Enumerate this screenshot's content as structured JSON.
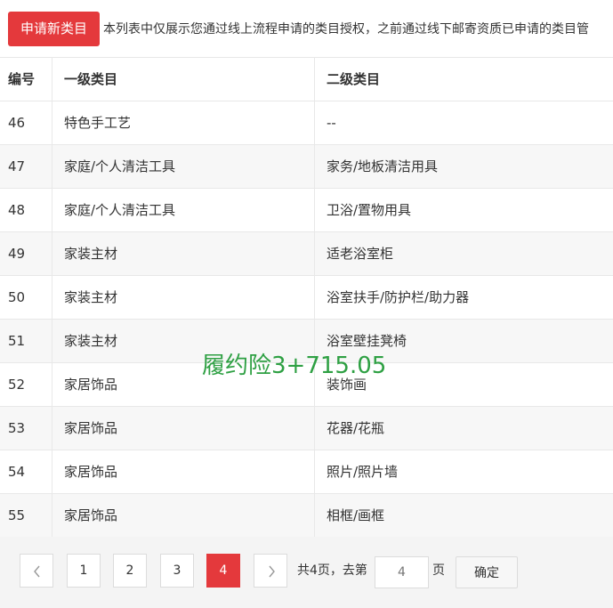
{
  "toolbar": {
    "apply_label": "申请新类目",
    "notice": "本列表中仅展示您通过线上流程申请的类目授权，之前通过线下邮寄资质已申请的类目管"
  },
  "table": {
    "headers": [
      "编号",
      "一级类目",
      "二级类目"
    ],
    "rows": [
      {
        "id": "46",
        "level1": "特色手工艺",
        "level2": "--"
      },
      {
        "id": "47",
        "level1": "家庭/个人清洁工具",
        "level2": "家务/地板清洁用具"
      },
      {
        "id": "48",
        "level1": "家庭/个人清洁工具",
        "level2": "卫浴/置物用具"
      },
      {
        "id": "49",
        "level1": "家装主材",
        "level2": "适老浴室柜"
      },
      {
        "id": "50",
        "level1": "家装主材",
        "level2": "浴室扶手/防护栏/助力器"
      },
      {
        "id": "51",
        "level1": "家装主材",
        "level2": "浴室壁挂凳椅"
      },
      {
        "id": "52",
        "level1": "家居饰品",
        "level2": "装饰画"
      },
      {
        "id": "53",
        "level1": "家居饰品",
        "level2": "花器/花瓶"
      },
      {
        "id": "54",
        "level1": "家居饰品",
        "level2": "照片/照片墙"
      },
      {
        "id": "55",
        "level1": "家居饰品",
        "level2": "相框/画框"
      }
    ]
  },
  "overlay": {
    "watermark": "履约险3+715.05",
    "color": "#2ea043"
  },
  "pagination": {
    "pages": [
      "1",
      "2",
      "3",
      "4"
    ],
    "current": "4",
    "prev_icon": "chevron-left-icon",
    "next_icon": "chevron-right-icon",
    "total_text": "共4页，去第",
    "input_placeholder": "4",
    "unit": "页",
    "confirm_label": "确定"
  },
  "colors": {
    "accent": "#e4393c",
    "row_alt": "#f7f7f7",
    "border": "#e8e8e8"
  }
}
